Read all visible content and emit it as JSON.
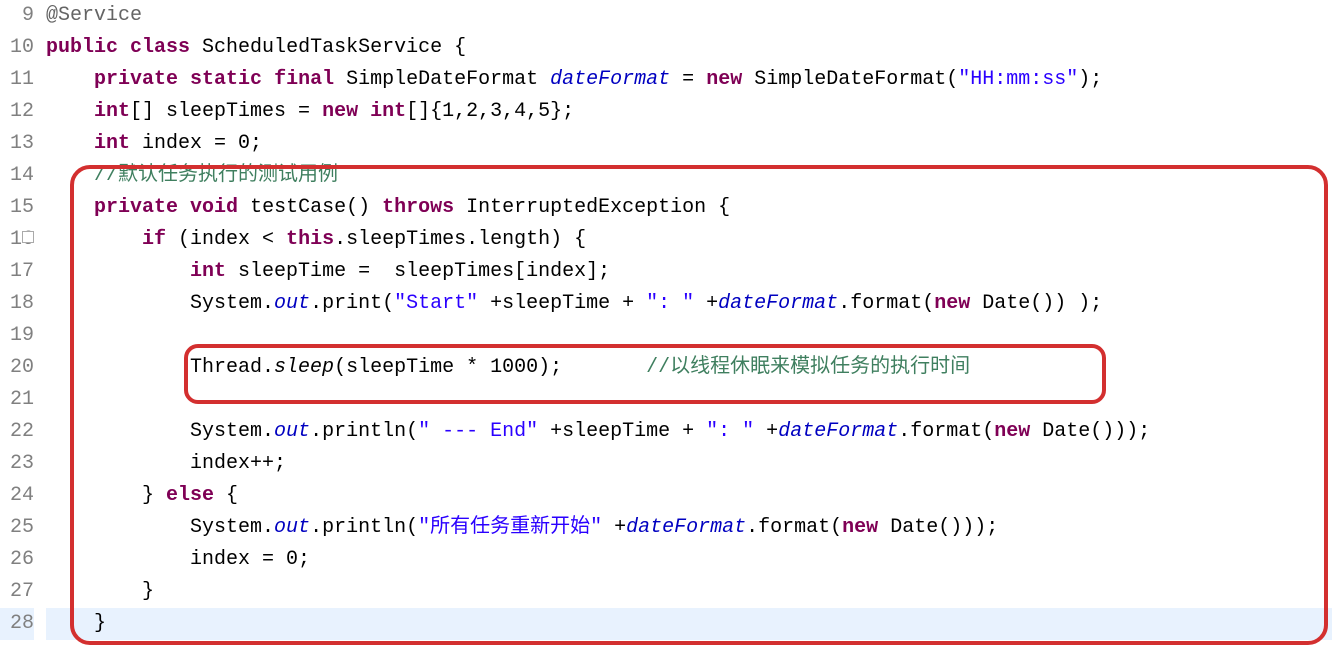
{
  "editor": {
    "lines": [
      {
        "num": 9,
        "segments": [
          {
            "t": "@Service",
            "c": "ann"
          }
        ]
      },
      {
        "num": 10,
        "segments": [
          {
            "t": "public",
            "c": "kw"
          },
          {
            "t": " ",
            "c": ""
          },
          {
            "t": "class",
            "c": "kw"
          },
          {
            "t": " ScheduledTaskService {",
            "c": ""
          }
        ]
      },
      {
        "num": 11,
        "segments": [
          {
            "t": "    ",
            "c": ""
          },
          {
            "t": "private",
            "c": "kw"
          },
          {
            "t": " ",
            "c": ""
          },
          {
            "t": "static",
            "c": "kw"
          },
          {
            "t": " ",
            "c": ""
          },
          {
            "t": "final",
            "c": "kw"
          },
          {
            "t": " SimpleDateFormat ",
            "c": ""
          },
          {
            "t": "dateFormat",
            "c": "field-it"
          },
          {
            "t": " = ",
            "c": ""
          },
          {
            "t": "new",
            "c": "kw"
          },
          {
            "t": " SimpleDateFormat(",
            "c": ""
          },
          {
            "t": "\"HH:mm:ss\"",
            "c": "str"
          },
          {
            "t": ");",
            "c": ""
          }
        ]
      },
      {
        "num": 12,
        "segments": [
          {
            "t": "    ",
            "c": ""
          },
          {
            "t": "int",
            "c": "kw"
          },
          {
            "t": "[] sleepTimes = ",
            "c": ""
          },
          {
            "t": "new",
            "c": "kw"
          },
          {
            "t": " ",
            "c": ""
          },
          {
            "t": "int",
            "c": "kw"
          },
          {
            "t": "[]{1,2,3,4,5};",
            "c": ""
          }
        ]
      },
      {
        "num": 13,
        "segments": [
          {
            "t": "    ",
            "c": ""
          },
          {
            "t": "int",
            "c": "kw"
          },
          {
            "t": " index = 0;",
            "c": ""
          }
        ]
      },
      {
        "num": 14,
        "segments": [
          {
            "t": "    ",
            "c": ""
          },
          {
            "t": "//默认任务执行的测试用例",
            "c": "com"
          }
        ]
      },
      {
        "num": 15,
        "collapse": true,
        "segments": [
          {
            "t": "    ",
            "c": ""
          },
          {
            "t": "private",
            "c": "kw"
          },
          {
            "t": " ",
            "c": ""
          },
          {
            "t": "void",
            "c": "kw"
          },
          {
            "t": " testCase() ",
            "c": ""
          },
          {
            "t": "throws",
            "c": "kw"
          },
          {
            "t": " InterruptedException {",
            "c": ""
          }
        ]
      },
      {
        "num": 16,
        "segments": [
          {
            "t": "        ",
            "c": ""
          },
          {
            "t": "if",
            "c": "kw"
          },
          {
            "t": " (index < ",
            "c": ""
          },
          {
            "t": "this",
            "c": "kw"
          },
          {
            "t": ".sleepTimes.length) {",
            "c": ""
          }
        ]
      },
      {
        "num": 17,
        "segments": [
          {
            "t": "            ",
            "c": ""
          },
          {
            "t": "int",
            "c": "kw"
          },
          {
            "t": " sleepTime =  sleepTimes[index];",
            "c": ""
          }
        ]
      },
      {
        "num": 18,
        "segments": [
          {
            "t": "            System.",
            "c": ""
          },
          {
            "t": "out",
            "c": "field-it"
          },
          {
            "t": ".print(",
            "c": ""
          },
          {
            "t": "\"Start\"",
            "c": "str"
          },
          {
            "t": " +sleepTime + ",
            "c": ""
          },
          {
            "t": "\": \"",
            "c": "str"
          },
          {
            "t": " +",
            "c": ""
          },
          {
            "t": "dateFormat",
            "c": "field-it"
          },
          {
            "t": ".format(",
            "c": ""
          },
          {
            "t": "new",
            "c": "kw"
          },
          {
            "t": " Date()) );",
            "c": ""
          }
        ]
      },
      {
        "num": 19,
        "segments": [
          {
            "t": "",
            "c": ""
          }
        ]
      },
      {
        "num": 20,
        "segments": [
          {
            "t": "            Thread.",
            "c": ""
          },
          {
            "t": "sleep",
            "c": "method-it"
          },
          {
            "t": "(sleepTime * 1000);       ",
            "c": ""
          },
          {
            "t": "//以线程休眠来模拟任务的执行时间",
            "c": "com"
          }
        ]
      },
      {
        "num": 21,
        "segments": [
          {
            "t": "",
            "c": ""
          }
        ]
      },
      {
        "num": 22,
        "segments": [
          {
            "t": "            System.",
            "c": ""
          },
          {
            "t": "out",
            "c": "field-it"
          },
          {
            "t": ".println(",
            "c": ""
          },
          {
            "t": "\" --- End\"",
            "c": "str"
          },
          {
            "t": " +sleepTime + ",
            "c": ""
          },
          {
            "t": "\": \"",
            "c": "str"
          },
          {
            "t": " +",
            "c": ""
          },
          {
            "t": "dateFormat",
            "c": "field-it"
          },
          {
            "t": ".format(",
            "c": ""
          },
          {
            "t": "new",
            "c": "kw"
          },
          {
            "t": " Date()));",
            "c": ""
          }
        ]
      },
      {
        "num": 23,
        "segments": [
          {
            "t": "            index++;",
            "c": ""
          }
        ]
      },
      {
        "num": 24,
        "segments": [
          {
            "t": "        } ",
            "c": ""
          },
          {
            "t": "else",
            "c": "kw"
          },
          {
            "t": " {",
            "c": ""
          }
        ]
      },
      {
        "num": 25,
        "segments": [
          {
            "t": "            System.",
            "c": ""
          },
          {
            "t": "out",
            "c": "field-it"
          },
          {
            "t": ".println(",
            "c": ""
          },
          {
            "t": "\"所有任务重新开始\"",
            "c": "str"
          },
          {
            "t": " +",
            "c": ""
          },
          {
            "t": "dateFormat",
            "c": "field-it"
          },
          {
            "t": ".format(",
            "c": ""
          },
          {
            "t": "new",
            "c": "kw"
          },
          {
            "t": " Date()));",
            "c": ""
          }
        ]
      },
      {
        "num": 26,
        "segments": [
          {
            "t": "            index = 0;",
            "c": ""
          }
        ]
      },
      {
        "num": 27,
        "segments": [
          {
            "t": "        }",
            "c": ""
          }
        ]
      },
      {
        "num": 28,
        "highlight": true,
        "segments": [
          {
            "t": "    }",
            "c": ""
          }
        ]
      }
    ]
  }
}
